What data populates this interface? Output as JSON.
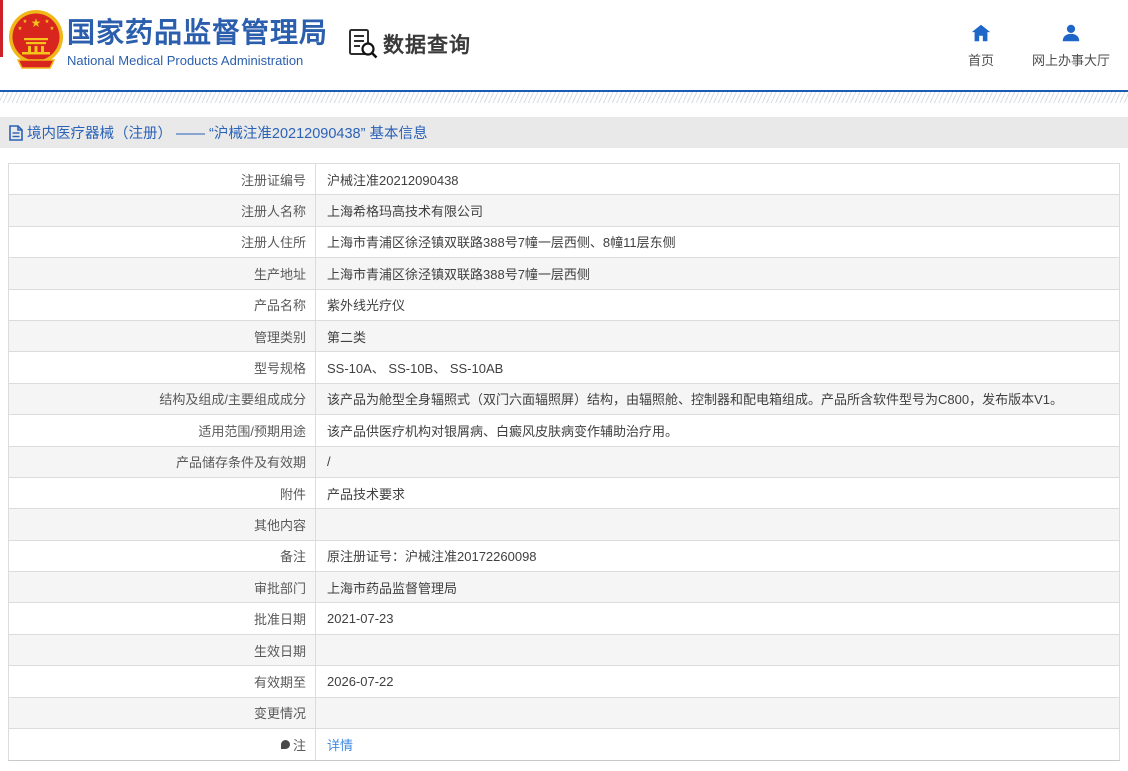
{
  "header": {
    "title": "国家药品监督管理局",
    "subtitle": "National Medical Products Administration",
    "data_query_label": "数据查询",
    "nav": {
      "home_label": "首页",
      "hall_label": "网上办事大厅"
    },
    "icons": {
      "emblem": "national-emblem-icon",
      "data_query": "document-search-icon",
      "home": "home-icon",
      "hall": "person-icon"
    }
  },
  "breadcrumb": {
    "text": "境内医疗器械（注册） —— “沪械注准20212090438” 基本信息",
    "icon": "file-icon"
  },
  "table": {
    "rows": [
      {
        "label": "注册证编号",
        "value": "沪械注准20212090438"
      },
      {
        "label": "注册人名称",
        "value": "上海希格玛高技术有限公司"
      },
      {
        "label": "注册人住所",
        "value": "上海市青浦区徐泾镇双联路388号7幢一层西侧、8幢11层东侧"
      },
      {
        "label": "生产地址",
        "value": "上海市青浦区徐泾镇双联路388号7幢一层西侧"
      },
      {
        "label": "产品名称",
        "value": "紫外线光疗仪"
      },
      {
        "label": "管理类别",
        "value": "第二类"
      },
      {
        "label": "型号规格",
        "value": "SS-10A、 SS-10B、 SS-10AB"
      },
      {
        "label": "结构及组成/主要组成成分",
        "value": "该产品为舱型全身辐照式（双门六面辐照屏）结构，由辐照舱、控制器和配电箱组成。产品所含软件型号为C800，发布版本V1。"
      },
      {
        "label": "适用范围/预期用途",
        "value": "该产品供医疗机构对银屑病、白癜风皮肤病变作辅助治疗用。"
      },
      {
        "label": "产品储存条件及有效期",
        "value": "/"
      },
      {
        "label": "附件",
        "value": "产品技术要求"
      },
      {
        "label": "其他内容",
        "value": ""
      },
      {
        "label": "备注",
        "value": "原注册证号：沪械注准20172260098"
      },
      {
        "label": "审批部门",
        "value": "上海市药品监督管理局"
      },
      {
        "label": "批准日期",
        "value": "2021-07-23"
      },
      {
        "label": "生效日期",
        "value": ""
      },
      {
        "label": "有效期至",
        "value": "2026-07-22"
      },
      {
        "label": "变更情况",
        "value": ""
      },
      {
        "label": "注",
        "value": "详情",
        "link": true,
        "label_icon": "note-balloon-icon"
      }
    ]
  },
  "colors": {
    "brand_blue": "#2b5fad",
    "nav_icon_blue": "#1f66c9",
    "header_rule_blue": "#1a5bb5",
    "breadcrumb_bg": "#e9e9e9",
    "breadcrumb_text": "#2a62b8",
    "link_blue": "#3f8be0",
    "row_alt_bg": "#f5f5f5",
    "table_border": "#dcdcdc",
    "label_text": "#595959",
    "value_text": "#404040",
    "emblem_red": "#d8261e",
    "emblem_gold": "#f5c31a"
  }
}
